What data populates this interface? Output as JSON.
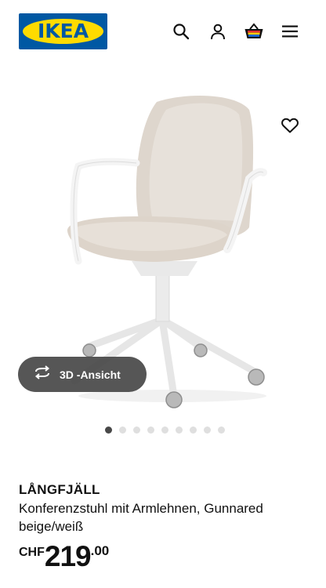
{
  "header": {
    "logo_text": "IKEA",
    "icons": [
      "search-icon",
      "user-icon",
      "basket-icon",
      "menu-icon"
    ]
  },
  "gallery": {
    "ar_button_label": "3D -Ansicht",
    "slide_count": 9,
    "active_slide": 1
  },
  "product": {
    "name": "LÅNGFJÄLL",
    "description": "Konferenzstuhl mit Armlehnen, Gunnared beige/weiß",
    "price": {
      "currency": "CHF",
      "integer": "219",
      "decimal": ".00"
    }
  },
  "colors": {
    "ikea_blue": "#0058a3",
    "ikea_yellow": "#ffdb00",
    "text": "#111111"
  }
}
